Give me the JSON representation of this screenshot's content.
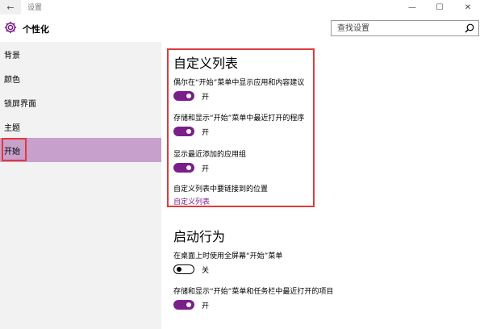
{
  "window": {
    "title": "设置",
    "back": "←",
    "minimize": "—",
    "maximize": "☐",
    "close": "✕"
  },
  "header": {
    "title": "个性化",
    "search_placeholder": "查找设置"
  },
  "sidebar": {
    "items": [
      {
        "label": "背景"
      },
      {
        "label": "颜色"
      },
      {
        "label": "锁屏界面"
      },
      {
        "label": "主题"
      },
      {
        "label": "开始"
      }
    ]
  },
  "main": {
    "section1": {
      "title": "自定义列表",
      "settings": [
        {
          "label": "偶尔在“开始”菜单中显示应用和内容建议",
          "state": "开",
          "on": true
        },
        {
          "label": "存储和显示“开始”菜单中最近打开的程序",
          "state": "开",
          "on": true
        },
        {
          "label": "显示最近添加的应用组",
          "state": "开",
          "on": true
        }
      ],
      "sub_label": "自定义列表中要链接到的位置",
      "link": "自定义列表"
    },
    "section2": {
      "title": "启动行为",
      "settings": [
        {
          "label": "在桌面上时使用全屏幕“开始”菜单",
          "state": "关",
          "on": false
        },
        {
          "label": "存储和显示“开始”菜单和任务栏中最近打开的项目",
          "state": "开",
          "on": true
        }
      ]
    }
  },
  "colors": {
    "accent": "#7a1f8a",
    "selected_nav": "#c8a0cc",
    "highlight": "#e03a3a"
  }
}
